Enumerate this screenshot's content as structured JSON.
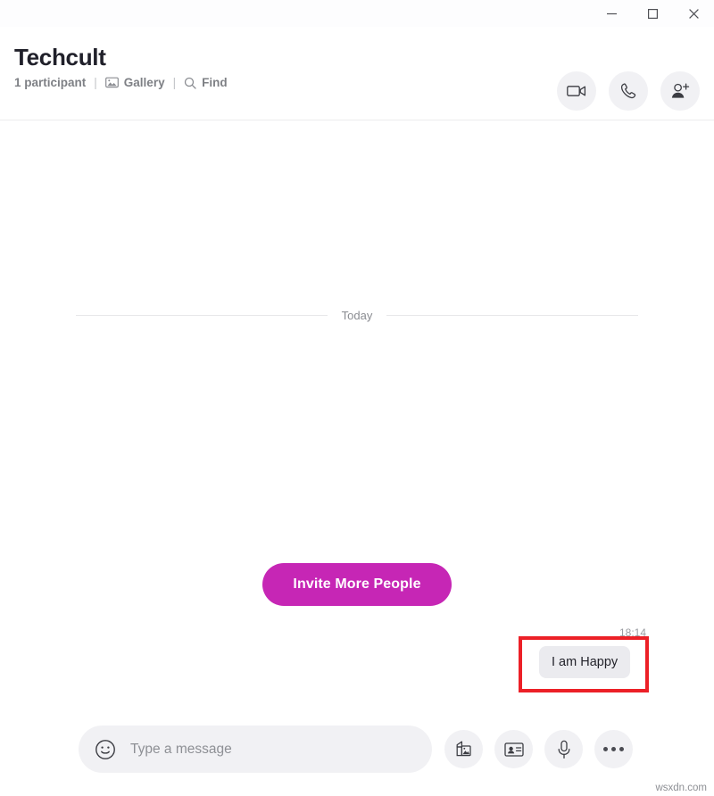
{
  "window": {
    "minimize_label": "Minimize",
    "maximize_label": "Maximize",
    "close_label": "Close"
  },
  "header": {
    "title": "Techcult",
    "participants": "1 participant",
    "separator": "|",
    "gallery_label": "Gallery",
    "find_label": "Find",
    "actions": [
      {
        "name": "video-call",
        "icon": "video-camera-icon"
      },
      {
        "name": "audio-call",
        "icon": "phone-icon"
      },
      {
        "name": "add-people",
        "icon": "add-person-icon"
      }
    ]
  },
  "chat": {
    "day_label": "Today",
    "invite_label": "Invite More People",
    "message": {
      "text": "I am Happy",
      "time": "18:14",
      "highlighted": true
    }
  },
  "composer": {
    "placeholder": "Type a message",
    "value": "",
    "emoji_icon": "smiley-icon",
    "actions": [
      {
        "name": "send-media",
        "icon": "image-stack-icon"
      },
      {
        "name": "send-contact",
        "icon": "contact-card-icon"
      },
      {
        "name": "voice-message",
        "icon": "microphone-icon"
      },
      {
        "name": "more-options",
        "icon": "ellipsis-icon"
      }
    ]
  },
  "colors": {
    "accent": "#c626b5",
    "highlight": "#ec2027",
    "bubble": "#ebebef",
    "control_bg": "#f1f1f4"
  },
  "watermark": "wsxdn.com"
}
